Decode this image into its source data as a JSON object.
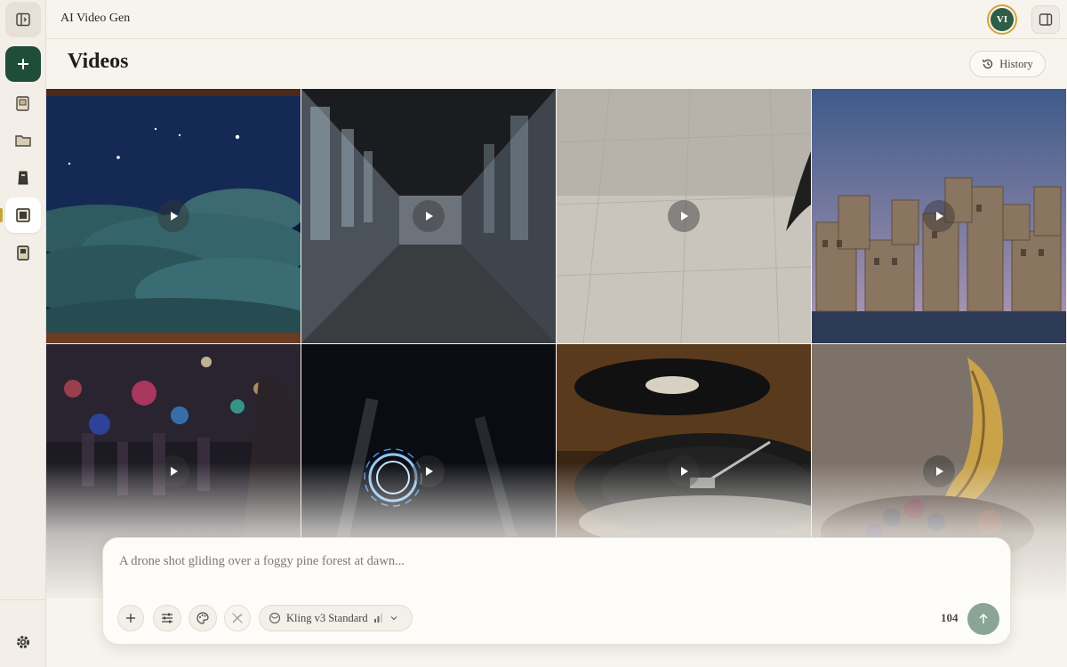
{
  "app": {
    "title": "AI Video Gen"
  },
  "user": {
    "initials": "VI"
  },
  "page": {
    "title": "Videos"
  },
  "header": {
    "history_label": "History"
  },
  "sidebar": {
    "items": [
      {
        "name": "toggle-sidebar",
        "icon": "sidebar-toggle-icon"
      },
      {
        "name": "new",
        "icon": "plus-icon"
      },
      {
        "name": "images",
        "icon": "image-book-icon"
      },
      {
        "name": "folders",
        "icon": "folder-icon"
      },
      {
        "name": "audio",
        "icon": "audio-icon"
      },
      {
        "name": "videos",
        "icon": "video-book-icon",
        "active": true
      },
      {
        "name": "gallery",
        "icon": "gallery-icon"
      }
    ],
    "settings_icon": "gear-icon"
  },
  "videos": [
    {
      "subject": "knitted-hills-night"
    },
    {
      "subject": "abandoned-hallway"
    },
    {
      "subject": "tiled-floor-crow"
    },
    {
      "subject": "cardboard-city"
    },
    {
      "subject": "city-street-bokeh"
    },
    {
      "subject": "glowing-ring"
    },
    {
      "subject": "vinyl-record-player"
    },
    {
      "subject": "decorated-banana"
    }
  ],
  "prompt": {
    "placeholder": "A drone shot gliding over a foggy pine forest at dawn...",
    "model": "Kling v3 Standard",
    "credits": "104"
  },
  "colors": {
    "accent": "#1f4d3a",
    "avatar_ring": "#d3a437",
    "send": "#8aa596"
  }
}
